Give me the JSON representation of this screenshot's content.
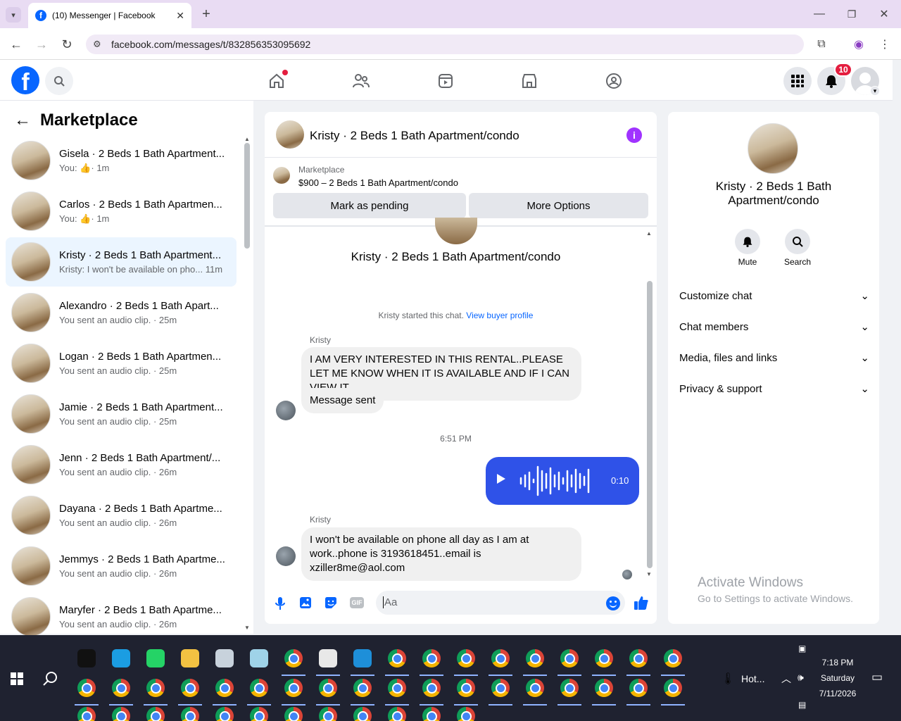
{
  "browser": {
    "tab_title": "(10) Messenger | Facebook",
    "url": "facebook.com/messages/t/832856353095692"
  },
  "header": {
    "notification_count": "10"
  },
  "sidebar": {
    "title": "Marketplace",
    "conversations": [
      {
        "name": "Gisela · 2 Beds 1 Bath Apartment...",
        "preview": "You:",
        "time": "· 1m",
        "like": true
      },
      {
        "name": "Carlos · 2 Beds 1 Bath Apartmen...",
        "preview": "You:",
        "time": "· 1m",
        "like": true
      },
      {
        "name": "Kristy · 2 Beds 1 Bath Apartment...",
        "preview": "Kristy: I won't be available on pho...",
        "time": "11m",
        "like": false,
        "active": true
      },
      {
        "name": "Alexandro · 2 Beds 1 Bath Apart...",
        "preview": "You sent an audio clip.",
        "time": "· 25m"
      },
      {
        "name": "Logan · 2 Beds 1 Bath Apartmen...",
        "preview": "You sent an audio clip.",
        "time": "· 25m"
      },
      {
        "name": "Jamie · 2 Beds 1 Bath Apartment...",
        "preview": "You sent an audio clip.",
        "time": "· 25m"
      },
      {
        "name": "Jenn · 2 Beds 1 Bath Apartment/...",
        "preview": "You sent an audio clip.",
        "time": "· 26m"
      },
      {
        "name": "Dayana · 2 Beds 1 Bath Apartme...",
        "preview": "You sent an audio clip.",
        "time": "· 26m"
      },
      {
        "name": "Jemmys · 2 Beds 1 Bath Apartme...",
        "preview": "You sent an audio clip.",
        "time": "· 26m"
      },
      {
        "name": "Maryfer · 2 Beds 1 Bath Apartme...",
        "preview": "You sent an audio clip.",
        "time": "· 26m"
      }
    ]
  },
  "chat": {
    "title": "Kristy · 2 Beds 1 Bath Apartment/condo",
    "listing_label": "Marketplace",
    "listing_detail": "$900 – 2 Beds 1 Bath Apartment/condo",
    "mark_pending": "Mark as pending",
    "more_options": "More Options",
    "intro_name": "Kristy · 2 Beds 1 Bath Apartment/condo",
    "started_text": "Kristy started this chat.",
    "view_profile": "View buyer profile",
    "sender1": "Kristy",
    "msg1": "I AM VERY INTERESTED IN THIS RENTAL..PLEASE LET ME KNOW WHEN IT IS AVAILABLE AND IF I CAN VIEW IT",
    "msg2": "Message sent",
    "timestamp": "6:51 PM",
    "audio_duration": "0:10",
    "sender2": "Kristy",
    "msg3": "I won't be available on phone all day as I am at work..phone is 3193618451..email is xziller8me@aol.com",
    "composer_placeholder": "Aa"
  },
  "info": {
    "name": "Kristy · 2 Beds 1 Bath Apartment/condo",
    "mute": "Mute",
    "search": "Search",
    "sections": [
      "Customize chat",
      "Chat members",
      "Media, files and links",
      "Privacy & support"
    ]
  },
  "watermark": {
    "title": "Activate Windows",
    "sub": "Go to Settings to activate Windows."
  },
  "taskbar": {
    "weather": "Hot...",
    "time": "7:18 PM",
    "day": "Saturday",
    "date": "7/11/2026"
  },
  "colors": {
    "fb_blue": "#0866ff",
    "messenger_blue": "#2f52e8",
    "purple": "#a033ff",
    "badge_red": "#e41e3f"
  }
}
